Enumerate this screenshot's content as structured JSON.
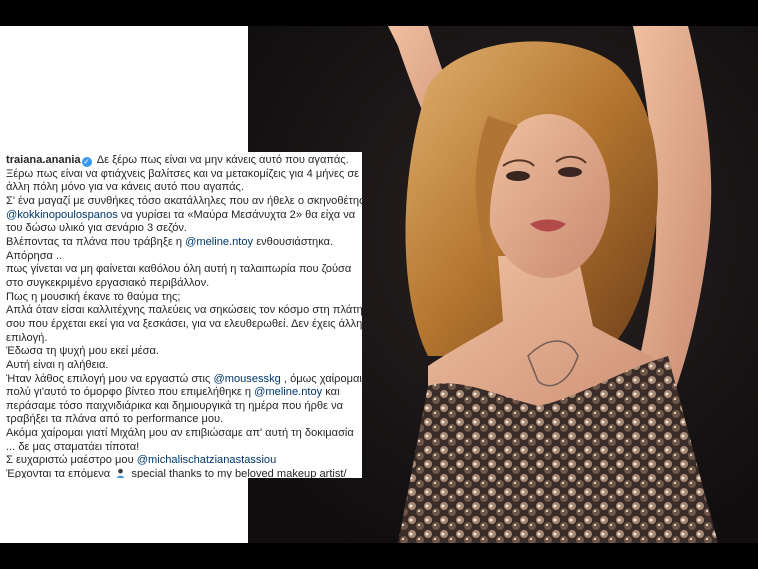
{
  "caption": {
    "username": "traiana.anania",
    "lines": [
      {
        "parts": [
          {
            "t": "Δε ξέρω πως είναι να μην κάνεις αυτό που αγαπάς."
          }
        ]
      },
      {
        "parts": [
          {
            "t": "Ξέρω πως είναι να φτιάχνεις βαλίτσες και να μετακομίζεις για 4 μήνες σε"
          }
        ]
      },
      {
        "parts": [
          {
            "t": "άλλη πόλη μόνο για να κάνεις αυτό που αγαπάς."
          }
        ]
      },
      {
        "parts": [
          {
            "t": "Σ' ένα μαγαζί με συνθήκες τόσο ακατάλληλες που αν ήθελε ο σκηνοθέτης"
          }
        ]
      },
      {
        "parts": [
          {
            "t": "@kokkinopoulospanos",
            "m": true
          },
          {
            "t": " να γυρίσει τα «Μαύρα Μεσάνυχτα 2» θα είχα να"
          }
        ]
      },
      {
        "parts": [
          {
            "t": "του δώσω υλικό για σενάριο 3 σεζόν."
          }
        ]
      },
      {
        "parts": [
          {
            "t": "Βλέποντας τα πλάνα που τράβηξε η "
          },
          {
            "t": "@meline.ntoy",
            "m": true
          },
          {
            "t": " ενθουσιάστηκα."
          }
        ]
      },
      {
        "parts": [
          {
            "t": "Απόρησα .."
          }
        ]
      },
      {
        "parts": [
          {
            "t": "πως γίνεται να μη φαίνεται καθόλου όλη αυτή η ταλαιπωρία που ζούσα"
          }
        ]
      },
      {
        "parts": [
          {
            "t": "στο συγκεκριμένο εργασιακό περιβάλλον."
          }
        ]
      },
      {
        "parts": [
          {
            "t": "Πως η μουσική έκανε το θαύμα της;"
          }
        ]
      },
      {
        "parts": [
          {
            "t": "Απλά όταν είσαι καλλιτέχνης παλεύεις να σηκώσεις τον κόσμο στη πλάτη"
          }
        ]
      },
      {
        "parts": [
          {
            "t": "σου που έρχεται εκεί για να ξεσκάσει, για να ελευθερωθεί. Δεν έχεις άλλη"
          }
        ]
      },
      {
        "parts": [
          {
            "t": "επιλογή."
          }
        ]
      },
      {
        "parts": [
          {
            "t": "Έδωσα τη ψυχή μου εκεί μέσα."
          }
        ]
      },
      {
        "parts": [
          {
            "t": "Αυτή είναι η αλήθεια."
          }
        ]
      },
      {
        "parts": [
          {
            "t": "Ήταν λάθος επιλογή μου να εργαστώ στις "
          },
          {
            "t": "@mousesskg",
            "m": true
          },
          {
            "t": " , όμως χαίρομαι"
          }
        ]
      },
      {
        "parts": [
          {
            "t": "πολύ γι'αυτό το όμορφο βίντεο που επιμελήθηκε η "
          },
          {
            "t": "@meline.ntoy",
            "m": true
          },
          {
            "t": " και"
          }
        ]
      },
      {
        "parts": [
          {
            "t": "περάσαμε τόσο παιχνιδιάρικα και δημιουργικά τη ημέρα που ήρθε να"
          }
        ]
      },
      {
        "parts": [
          {
            "t": "τραβήξει τα πλάνα από το performance μου."
          }
        ]
      },
      {
        "parts": [
          {
            "t": "Ακόμα χαίρομαι γιατί Μιχάλη μου αν επιβιώσαμε απ' αυτή τη δοκιμασία"
          }
        ]
      },
      {
        "parts": [
          {
            "t": "... δε μας σταματάει τίποτα!"
          }
        ]
      },
      {
        "parts": [
          {
            "t": "Σ ευχαριστώ μαέστρο μου "
          },
          {
            "t": "@michalischatzianastassiou",
            "m": true
          }
        ]
      },
      {
        "parts": [
          {
            "t": "Έρχονται τα επόμενα "
          },
          {
            "icon": "person-emoji-icon"
          },
          {
            "t": " special thanks to my beloved makeup artist/"
          }
        ]
      }
    ]
  },
  "photo": {
    "subject": "portrait-photo",
    "colors": {
      "background": "#121012",
      "hair": "#c48a3e",
      "skin": "#e0a888",
      "sequins": "#8a7060"
    }
  }
}
